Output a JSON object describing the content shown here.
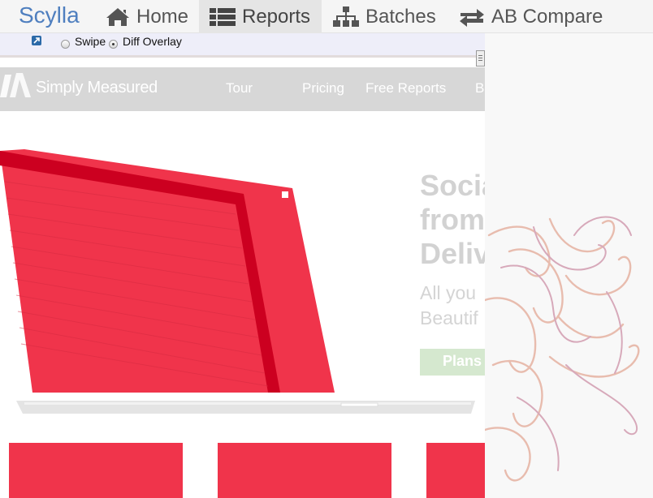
{
  "app": {
    "brand": "Scylla",
    "nav": [
      {
        "label": "Home",
        "icon": "home-icon",
        "active": false
      },
      {
        "label": "Reports",
        "icon": "list-icon",
        "active": true
      },
      {
        "label": "Batches",
        "icon": "sitemap-icon",
        "active": false
      },
      {
        "label": "AB Compare",
        "icon": "exchange-icon",
        "active": false
      }
    ]
  },
  "diff_controls": {
    "open_icon": "external-link-icon",
    "modes": [
      {
        "label": "Swipe",
        "checked": false
      },
      {
        "label": "Diff Overlay",
        "checked": true
      }
    ]
  },
  "screenshot": {
    "site_logo": "Simply Measured",
    "site_nav": [
      "Tour",
      "Pricing",
      "Free Reports",
      "B"
    ],
    "hero_lines": [
      "Socia",
      "from",
      "Deliv"
    ],
    "hero_sub_lines": [
      "All you",
      "Beautif"
    ],
    "cta": "Plans",
    "diff_color": "#f0344b"
  },
  "colors": {
    "brand": "#4f7fbf",
    "nav_active_bg": "#e5e5e5",
    "diff_red": "#f0344b",
    "gutter_bg": "#f8f8f8"
  }
}
